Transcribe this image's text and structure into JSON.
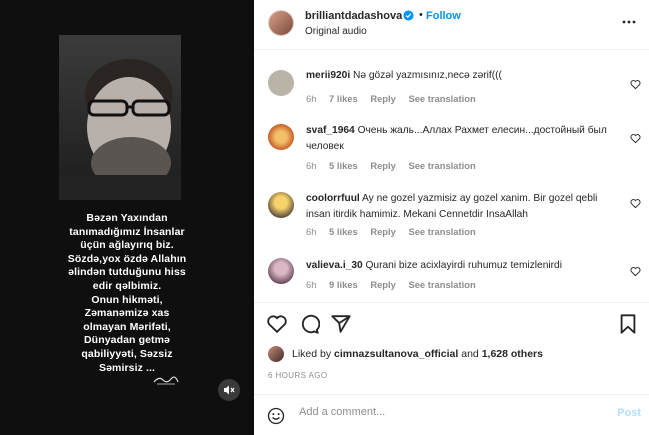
{
  "media": {
    "caption_lines": [
      "Bəzən Yaxından",
      "tanımadığımız İnsanlar",
      "üçün ağlayırıq biz.",
      "Sözdə,yox özdə Allahın",
      "əlindən tutduğunu hiss",
      "edir qəlbimiz.",
      "Onun hikməti,",
      "Zəmanəmizə xas",
      "olmayan Mərifəti,",
      "Dünyadan getmə",
      "qabiliyyəti, Səzsiz",
      "Səmirsiz ..."
    ],
    "mute_icon": "speaker-muted-icon"
  },
  "header": {
    "username": "brilliantdadashova",
    "separator": "•",
    "follow_label": "Follow",
    "audio": "Original audio"
  },
  "comments": [
    {
      "username": "merii920i",
      "text": "Nə gözəl yazmısınız,necə zərif(((",
      "age": "6h",
      "likes": "7 likes",
      "reply": "Reply",
      "translate": "See translation",
      "avatar_color": "#b9b3a8"
    },
    {
      "username": "svaf_1964",
      "text": "Очень жаль...Аллах Рахмет елесин...достойный был человек",
      "age": "6h",
      "likes": "5 likes",
      "reply": "Reply",
      "translate": "See translation",
      "avatar_color": "#d9902e"
    },
    {
      "username": "coolorrfuul",
      "text": "Ay ne gozel yazmisiz ay gozel xanim. Bir gozel qebli insan itirdik hamimiz. Mekani Cennetdir InsaAllah",
      "age": "6h",
      "likes": "5 likes",
      "reply": "Reply",
      "translate": "See translation",
      "avatar_color": "#e0b24a"
    },
    {
      "username": "valieva.i_30",
      "text": "Qurani bize acixlayirdi ruhumuz temizlenirdi",
      "age": "6h",
      "likes": "9 likes",
      "reply": "Reply",
      "translate": "See translation",
      "avatar_color": "#8a6a7a"
    }
  ],
  "likes_line": {
    "prefix": "Liked by",
    "user": "cimnazsultanova_official",
    "conj": "and",
    "others": "1,628 others"
  },
  "timestamp": "6 HOURS AGO",
  "add_comment": {
    "placeholder": "Add a comment...",
    "post_label": "Post"
  },
  "colors": {
    "link_blue": "#0095f6",
    "post_disabled": "#b2dffc",
    "muted": "#8e8e8e"
  }
}
